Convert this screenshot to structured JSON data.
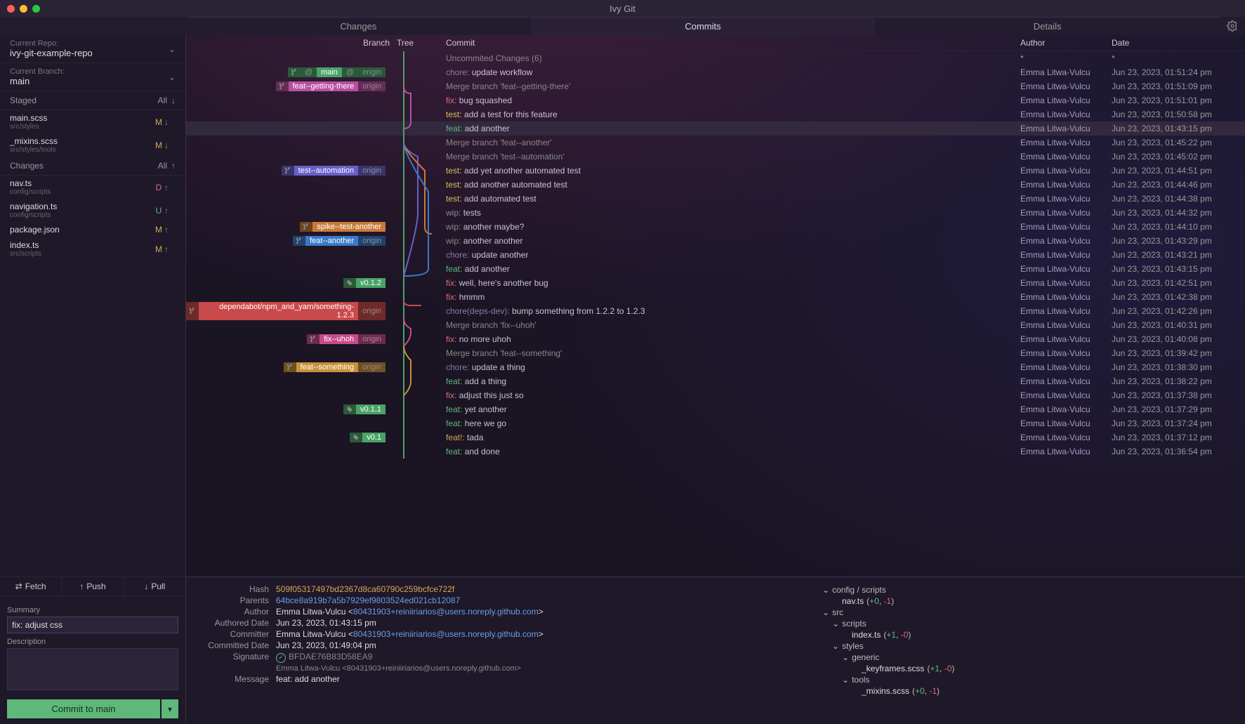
{
  "app_title": "Ivy Git",
  "tabs": [
    "Changes",
    "Commits",
    "Details"
  ],
  "active_tab": 1,
  "repo": {
    "label": "Current Repo:",
    "value": "ivy-git-example-repo"
  },
  "branch": {
    "label": "Current Branch:",
    "value": "main"
  },
  "staged": {
    "title": "Staged",
    "all": "All",
    "files": [
      {
        "name": "main.scss",
        "path": "src/styles",
        "status": "M"
      },
      {
        "name": "_mixins.scss",
        "path": "src/styles/tools",
        "status": "M"
      }
    ]
  },
  "changes": {
    "title": "Changes",
    "all": "All",
    "files": [
      {
        "name": "nav.ts",
        "path": "config/scripts",
        "status": "D"
      },
      {
        "name": "navigation.ts",
        "path": "config/scripts",
        "status": "U"
      },
      {
        "name": "package.json",
        "path": "",
        "status": "M"
      },
      {
        "name": "index.ts",
        "path": "src/scripts",
        "status": "M"
      }
    ]
  },
  "actions": {
    "fetch": "Fetch",
    "push": "Push",
    "pull": "Pull"
  },
  "form": {
    "summary_label": "Summary",
    "summary_value": "fix: adjust css",
    "description_label": "Description",
    "description_value": "",
    "commit_btn": "Commit to main"
  },
  "columns": {
    "branch": "Branch",
    "tree": "Tree",
    "commit": "Commit",
    "author": "Author",
    "date": "Date"
  },
  "uncommitted": {
    "label": "Uncommited Changes (6)",
    "author": "*",
    "date": "*"
  },
  "branch_labels": {
    "main": {
      "name": "main",
      "at": "@",
      "origin": "origin",
      "color": "#4aa367"
    },
    "getting": {
      "name": "feat--getting-there",
      "origin": "origin",
      "color": "#b84fa1"
    },
    "automation": {
      "name": "test--automation",
      "origin": "origin",
      "color": "#6a5fc9"
    },
    "spike": {
      "name": "spike--test-another",
      "color": "#c97a3a"
    },
    "another": {
      "name": "feat--another",
      "origin": "origin",
      "color": "#3a7ac9"
    },
    "tag012": {
      "name": "v0.1.2",
      "color": "#4aa367",
      "tag": true
    },
    "dependabot": {
      "name": "dependabot/npm_and_yarn/something-1.2.3",
      "origin": "origin",
      "color": "#c94a4a"
    },
    "uhoh": {
      "name": "fix--uhoh",
      "origin": "origin",
      "color": "#c94a8a"
    },
    "something": {
      "name": "feat--something",
      "origin": "origin",
      "color": "#c9913a"
    },
    "tag011": {
      "name": "v0.1.1",
      "color": "#4aa367",
      "tag": true
    },
    "tag01": {
      "name": "v0.1",
      "color": "#4aa367",
      "tag": true
    }
  },
  "commits": [
    {
      "branches": [
        "main"
      ],
      "prefix": "chore",
      "msg": "update workflow",
      "author": "Emma Litwa-Vulcu",
      "date": "Jun 23, 2023, 01:51:24 pm"
    },
    {
      "branches": [
        "getting"
      ],
      "prefix": "merge",
      "msg": "Merge branch 'feat--getting-there'",
      "author": "Emma Litwa-Vulcu",
      "date": "Jun 23, 2023, 01:51:09 pm"
    },
    {
      "prefix": "fix",
      "msg": "bug squashed",
      "author": "Emma Litwa-Vulcu",
      "date": "Jun 23, 2023, 01:51:01 pm"
    },
    {
      "prefix": "test",
      "msg": "add a test for this feature",
      "author": "Emma Litwa-Vulcu",
      "date": "Jun 23, 2023, 01:50:58 pm"
    },
    {
      "prefix": "feat",
      "msg": "add another",
      "author": "Emma Litwa-Vulcu",
      "date": "Jun 23, 2023, 01:43:15 pm",
      "selected": true
    },
    {
      "prefix": "merge",
      "msg": "Merge branch 'feat--another'",
      "author": "Emma Litwa-Vulcu",
      "date": "Jun 23, 2023, 01:45:22 pm"
    },
    {
      "prefix": "merge",
      "msg": "Merge branch 'test--automation'",
      "author": "Emma Litwa-Vulcu",
      "date": "Jun 23, 2023, 01:45:02 pm"
    },
    {
      "branches": [
        "automation"
      ],
      "prefix": "test",
      "msg": "add yet another automated test",
      "author": "Emma Litwa-Vulcu",
      "date": "Jun 23, 2023, 01:44:51 pm"
    },
    {
      "prefix": "test",
      "msg": "add another automated test",
      "author": "Emma Litwa-Vulcu",
      "date": "Jun 23, 2023, 01:44:46 pm"
    },
    {
      "prefix": "test",
      "msg": "add automated test",
      "author": "Emma Litwa-Vulcu",
      "date": "Jun 23, 2023, 01:44:38 pm"
    },
    {
      "prefix": "wip",
      "msg": "tests",
      "author": "Emma Litwa-Vulcu",
      "date": "Jun 23, 2023, 01:44:32 pm"
    },
    {
      "branches": [
        "spike"
      ],
      "prefix": "wip",
      "msg": "another maybe?",
      "author": "Emma Litwa-Vulcu",
      "date": "Jun 23, 2023, 01:44:10 pm"
    },
    {
      "branches": [
        "another"
      ],
      "prefix": "wip",
      "msg": "another another",
      "author": "Emma Litwa-Vulcu",
      "date": "Jun 23, 2023, 01:43:29 pm"
    },
    {
      "prefix": "chore",
      "msg": "update another",
      "author": "Emma Litwa-Vulcu",
      "date": "Jun 23, 2023, 01:43:21 pm"
    },
    {
      "prefix": "feat",
      "msg": "add another",
      "author": "Emma Litwa-Vulcu",
      "date": "Jun 23, 2023, 01:43:15 pm"
    },
    {
      "branches": [
        "tag012"
      ],
      "prefix": "fix",
      "msg": "well, here's another bug",
      "author": "Emma Litwa-Vulcu",
      "date": "Jun 23, 2023, 01:42:51 pm"
    },
    {
      "prefix": "fix",
      "msg": "hmmm",
      "author": "Emma Litwa-Vulcu",
      "date": "Jun 23, 2023, 01:42:38 pm"
    },
    {
      "branches": [
        "dependabot"
      ],
      "prefix": "chore",
      "suffix": "(deps-dev)",
      "msg": "bump something from 1.2.2 to 1.2.3",
      "author": "Emma Litwa-Vulcu",
      "date": "Jun 23, 2023, 01:42:26 pm"
    },
    {
      "prefix": "merge",
      "msg": "Merge branch 'fix--uhoh'",
      "author": "Emma Litwa-Vulcu",
      "date": "Jun 23, 2023, 01:40:31 pm"
    },
    {
      "branches": [
        "uhoh"
      ],
      "prefix": "fix",
      "msg": "no more uhoh",
      "author": "Emma Litwa-Vulcu",
      "date": "Jun 23, 2023, 01:40:08 pm"
    },
    {
      "prefix": "merge",
      "msg": "Merge branch 'feat--something'",
      "author": "Emma Litwa-Vulcu",
      "date": "Jun 23, 2023, 01:39:42 pm"
    },
    {
      "branches": [
        "something"
      ],
      "prefix": "chore",
      "msg": "update a thing",
      "author": "Emma Litwa-Vulcu",
      "date": "Jun 23, 2023, 01:38:30 pm"
    },
    {
      "prefix": "feat",
      "msg": "add a thing",
      "author": "Emma Litwa-Vulcu",
      "date": "Jun 23, 2023, 01:38:22 pm"
    },
    {
      "prefix": "fix",
      "msg": "adjust this just so",
      "author": "Emma Litwa-Vulcu",
      "date": "Jun 23, 2023, 01:37:38 pm"
    },
    {
      "branches": [
        "tag011"
      ],
      "prefix": "feat",
      "msg": "yet another",
      "author": "Emma Litwa-Vulcu",
      "date": "Jun 23, 2023, 01:37:29 pm"
    },
    {
      "prefix": "feat",
      "msg": "here we go",
      "author": "Emma Litwa-Vulcu",
      "date": "Jun 23, 2023, 01:37:24 pm"
    },
    {
      "branches": [
        "tag01"
      ],
      "prefix": "feat!",
      "msg": "tada",
      "author": "Emma Litwa-Vulcu",
      "date": "Jun 23, 2023, 01:37:12 pm"
    },
    {
      "prefix": "feat",
      "msg": "and done",
      "author": "Emma Litwa-Vulcu",
      "date": "Jun 23, 2023, 01:36:54 pm"
    }
  ],
  "detail": {
    "hash_label": "Hash",
    "hash": "509f05317497bd2367d8ca60790c259bcfce722f",
    "parents_label": "Parents",
    "parents": "64bce8a919b7a5b7929ef9803524ed021cb12087",
    "author_label": "Author",
    "author_name": "Emma Litwa-Vulcu <",
    "author_email": "80431903+reiniiriarios@users.noreply.github.com",
    "author_close": ">",
    "authored_label": "Authored Date",
    "authored": "Jun 23, 2023, 01:43:15 pm",
    "committer_label": "Committer",
    "committer_name": "Emma Litwa-Vulcu <",
    "committer_email": "80431903+reiniiriarios@users.noreply.github.com",
    "committer_close": ">",
    "committed_label": "Committed Date",
    "committed": "Jun 23, 2023, 01:49:04 pm",
    "sig_label": "Signature",
    "sig_hash": "BFDAE76B83D58EA9",
    "sig_ident": "Emma Litwa-Vulcu <80431903+reiniiriarios@users.noreply.github.com>",
    "msg_label": "Message",
    "msg": "feat: add another"
  },
  "file_tree": {
    "config_scripts": "config / scripts",
    "nav": "nav.ts",
    "nav_diff": "(+0, -1)",
    "src": "src",
    "scripts": "scripts",
    "index": "index.ts",
    "index_diff": "(+1, -0)",
    "styles": "styles",
    "generic": "generic",
    "keyframes": "_keyframes.scss",
    "keyframes_diff": "(+1, -0)",
    "tools": "tools",
    "mixins": "_mixins.scss",
    "mixins_diff": "(+0, -1)"
  }
}
